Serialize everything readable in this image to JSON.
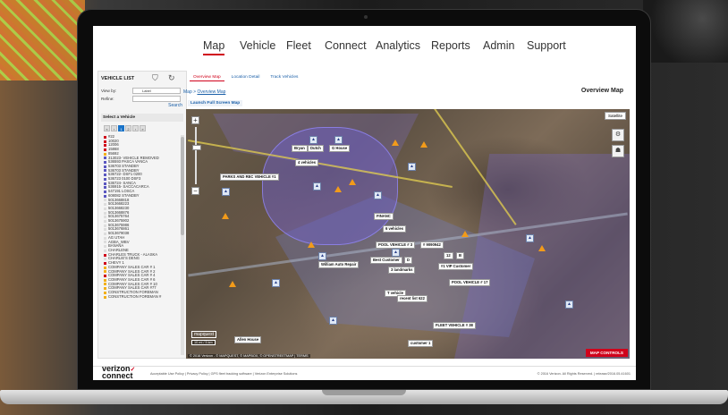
{
  "nav": {
    "items": [
      "Map",
      "Vehicle",
      "Fleet",
      "Connect",
      "Analytics",
      "Reports",
      "Admin",
      "Support"
    ],
    "active": "Map"
  },
  "sidebar": {
    "title": "VEHICLE LIST",
    "view_by_label": "View by:",
    "view_by_value": "Label",
    "refine_label": "Refine:",
    "search_label": "Search",
    "select_label": "Select a Vehicle",
    "pages": [
      "1",
      "2"
    ],
    "vehicles": [
      {
        "name": "#22",
        "color": "#d0021b"
      },
      {
        "name": "10020",
        "color": "#d0021b"
      },
      {
        "name": "12006",
        "color": "#d0021b"
      },
      {
        "name": "15868",
        "color": "#d0021b"
      },
      {
        "name": "85692",
        "color": "#f2b01a"
      },
      {
        "name": "313023- VEHICLE REMOVED",
        "color": "#5a57c0"
      },
      {
        "name": "536593 PASCA VANCA",
        "color": "#5a57c0"
      },
      {
        "name": "536703 STANDBY",
        "color": "#5a57c0"
      },
      {
        "name": "536703 STANDBY",
        "color": "#5a57c0"
      },
      {
        "name": "536722- DSF1 0200",
        "color": "#5a57c0"
      },
      {
        "name": "536723 0100 DSF3",
        "color": "#5a57c0"
      },
      {
        "name": "536724- SANCA",
        "color": "#5a57c0"
      },
      {
        "name": "536915- SACCACARCA",
        "color": "#5a57c0"
      },
      {
        "name": "547191 LOSCA",
        "color": "#5a57c0"
      },
      {
        "name": "608082 STANDBY",
        "color": "#5a57c0"
      },
      {
        "name": "5013668818",
        "color": "#dddddd"
      },
      {
        "name": "5013668223",
        "color": "#dddddd"
      },
      {
        "name": "5013668230",
        "color": "#dddddd"
      },
      {
        "name": "5013668876",
        "color": "#dddddd"
      },
      {
        "name": "5013675764",
        "color": "#dddddd"
      },
      {
        "name": "5013675902",
        "color": "#dddddd"
      },
      {
        "name": "5013675986",
        "color": "#dddddd"
      },
      {
        "name": "5013676861",
        "color": "#dddddd"
      },
      {
        "name": "5013679038",
        "color": "#dddddd"
      },
      {
        "name": "AG UTAH",
        "color": "#dddddd"
      },
      {
        "name": "AGBA_WBV",
        "color": "#dddddd"
      },
      {
        "name": "BANANA",
        "color": "#dddddd"
      },
      {
        "name": "CHARLENE",
        "color": "#dddddd"
      },
      {
        "name": "CHARLES TRUCK - ALASKA",
        "color": "#d0021b"
      },
      {
        "name": "CHARLIE'S DENG",
        "color": "#dddddd"
      },
      {
        "name": "CHEVY 1",
        "color": "#d0021b"
      },
      {
        "name": "COMPANY SALES CAR # 1",
        "color": "#f2b01a"
      },
      {
        "name": "COMPANY SALES CAR # 2",
        "color": "#f2b01a"
      },
      {
        "name": "COMPANY SALES CAR # 4",
        "color": "#d0021b"
      },
      {
        "name": "COMPANY SALES CAR # 6",
        "color": "#f2b01a"
      },
      {
        "name": "COMPANY SALES CAR # 10",
        "color": "#f2b01a"
      },
      {
        "name": "COMPANY SALES CAR #77",
        "color": "#f2b01a"
      },
      {
        "name": "CONSTRUCTION FOREMAN",
        "color": "#f2b01a"
      },
      {
        "name": "CONSTRUCTION FOREMAN #",
        "color": "#f2b01a"
      }
    ]
  },
  "tabs": [
    {
      "label": "Overview Map",
      "active": true
    },
    {
      "label": "Location Detail",
      "active": false
    },
    {
      "label": "Track Vehicles",
      "active": false
    }
  ],
  "breadcrumb": {
    "prefix": "Map > ",
    "current": "Overview Map"
  },
  "page_title": "Overview Map",
  "fullscreen_label": "Launch Full Screen Map",
  "map": {
    "layer": "Satellite",
    "labels": [
      "Bryan",
      "Dutch",
      "G House",
      "4 vehicles",
      "PARKS AND REC VEHICLE #1",
      "FINANC",
      "6 vehicles",
      "POOL VEHICLE # 3",
      "# 9090942",
      "Best Customer",
      "D",
      "12",
      "B",
      "#1 VIP Customer",
      "William Auto Repair",
      "3 landmarks",
      "POOL VEHICLE # 17",
      "T vehicle",
      "recent list 622",
      "FLEET VEHICLE # 38",
      "customer 1",
      "Allen House"
    ],
    "scale": "10 mi / 5 km",
    "copyright": "© 2016 Verizon - © MAPQUEST, © MAPBOX, © OPENSTREETMAP | TERMS",
    "controls_label": "MAP CONTROLS",
    "zoom_in": "+",
    "zoom_out": "−",
    "logo": "mapquest"
  },
  "footer": {
    "logo_line1": "verizon",
    "logo_line2": "connect",
    "links": "Acceptable Use Policy  |  Privacy Policy  |  GPS fleet tracking software  |  Verizon Enterprise Solutions",
    "right": "© 2016 Verizon. All Rights Reserved.   |   release/2016.05.41601"
  },
  "colors": {
    "accent": "#d0021b",
    "link": "#1a5fa8",
    "zone": "#6e5fd2"
  }
}
